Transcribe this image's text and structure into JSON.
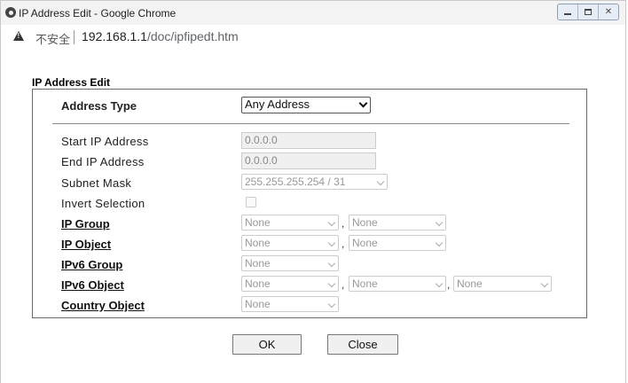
{
  "window": {
    "title": "IP Address Edit - Google Chrome",
    "buttons": [
      "minimize-icon",
      "maximize-icon",
      "close-icon"
    ]
  },
  "address_bar": {
    "security_text": "不安全",
    "url_host": "192.168.1.1",
    "url_path": "/doc/ipfipedt.htm"
  },
  "form": {
    "title": "IP Address Edit",
    "address_type": {
      "label": "Address Type",
      "value": "Any Address"
    },
    "start_ip": {
      "label": "Start IP Address",
      "value": "0.0.0.0"
    },
    "end_ip": {
      "label": "End IP Address",
      "value": "0.0.0.0"
    },
    "subnet_mask": {
      "label": "Subnet Mask",
      "value": "255.255.255.254 / 31"
    },
    "invert_selection": {
      "label": "Invert Selection",
      "checked": false
    },
    "ip_group": {
      "label": "IP Group",
      "values": [
        "None",
        "None"
      ]
    },
    "ip_object": {
      "label": "IP Object",
      "values": [
        "None",
        "None"
      ]
    },
    "ipv6_group": {
      "label": "IPv6 Group",
      "values": [
        "None"
      ]
    },
    "ipv6_object": {
      "label": "IPv6 Object",
      "values": [
        "None",
        "None",
        "None"
      ]
    },
    "country_object": {
      "label": "Country Object",
      "values": [
        "None"
      ]
    },
    "separator": ","
  },
  "buttons": {
    "ok": "OK",
    "close": "Close"
  }
}
